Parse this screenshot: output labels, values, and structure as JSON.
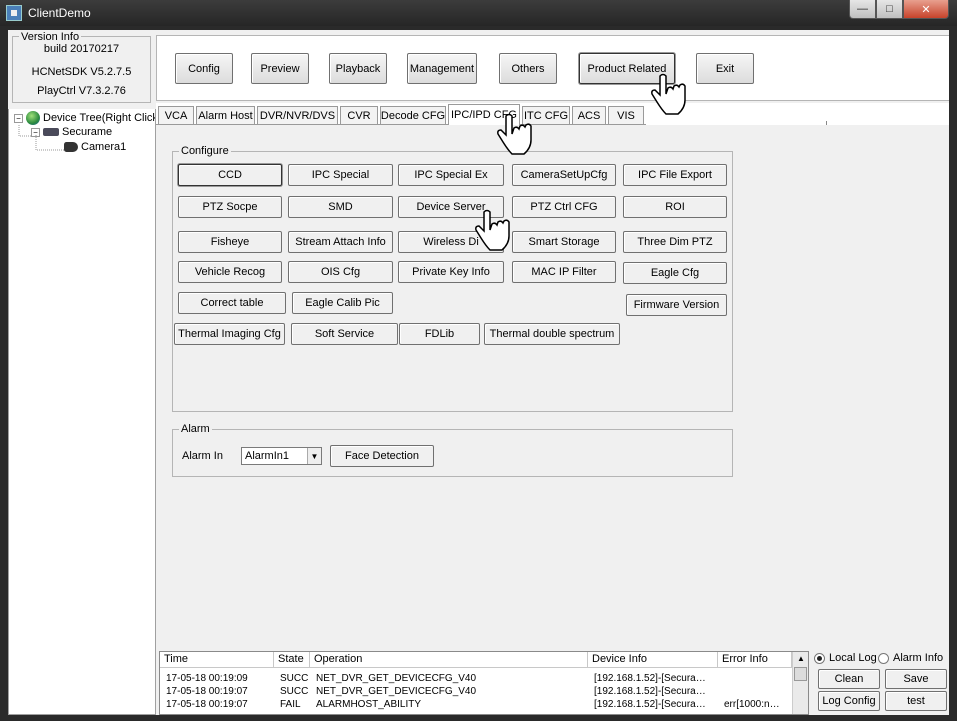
{
  "window": {
    "title": "ClientDemo",
    "controls": {
      "minimize": "—",
      "maximize": "□",
      "close": "✕"
    }
  },
  "version_info": {
    "legend": "Version Info",
    "build": "build 20170217",
    "sdk": "HCNetSDK V5.2.7.5",
    "playctrl": "PlayCtrl V7.3.2.76"
  },
  "top_buttons": [
    {
      "label": "Config"
    },
    {
      "label": "Preview"
    },
    {
      "label": "Playback"
    },
    {
      "label": "Management"
    },
    {
      "label": "Others"
    },
    {
      "label": "Product Related"
    },
    {
      "label": "Exit"
    }
  ],
  "device_tree": {
    "root": "Device Tree(Right Click t",
    "device": "Securame",
    "camera": "Camera1"
  },
  "tabs": [
    {
      "label": "VCA"
    },
    {
      "label": "Alarm Host"
    },
    {
      "label": "DVR/NVR/DVS"
    },
    {
      "label": "CVR"
    },
    {
      "label": "Decode CFG"
    },
    {
      "label": "IPC/IPD CFG"
    },
    {
      "label": "ITC CFG"
    },
    {
      "label": "ACS"
    },
    {
      "label": "VIS"
    }
  ],
  "active_tab": "IPC/IPD CFG",
  "configure": {
    "legend": "Configure",
    "buttons": {
      "ccd": "CCD",
      "ipc_special": "IPC Special",
      "ipc_special_ex": "IPC Special Ex",
      "camera_setup_cfg": "CameraSetUpCfg",
      "ipc_file_export": "IPC File Export",
      "ptz_scope": "PTZ Socpe",
      "smd": "SMD",
      "device_server": "Device Server",
      "ptz_ctrl_cfg": "PTZ  Ctrl CFG",
      "roi": "ROI",
      "fisheye": "Fisheye",
      "stream_attach_info": "Stream Attach Info",
      "wireless_dial": "Wireless Di",
      "smart_storage": "Smart Storage",
      "three_dim_ptz": "Three Dim PTZ",
      "vehicle_recog": "Vehicle Recog",
      "ois_cfg": "OIS Cfg",
      "private_key_info": "Private Key Info",
      "mac_ip_filter": "MAC IP Filter",
      "eagle_cfg": "Eagle Cfg",
      "correct_table": "Correct table",
      "eagle_calib_pic": "Eagle Calib Pic",
      "firmware_version": "Firmware Version",
      "thermal_imaging_cfg": "Thermal Imaging Cfg",
      "soft_service": "Soft Service",
      "fdlib": "FDLib",
      "thermal_double_spectrum": "Thermal double spectrum"
    }
  },
  "alarm": {
    "legend": "Alarm",
    "alarm_in_label": "Alarm In",
    "alarm_in_value": "AlarmIn1",
    "face_detection": "Face Detection"
  },
  "log": {
    "columns": [
      "Time",
      "State",
      "Operation",
      "Device Info",
      "Error Info"
    ],
    "rows": [
      {
        "time": "17-05-18 00:19:09",
        "state": "SUCC",
        "operation": "NET_DVR_GET_DEVICECFG_V40",
        "device": "[192.168.1.52]-[Secura…",
        "error": ""
      },
      {
        "time": "17-05-18 00:19:07",
        "state": "SUCC",
        "operation": "NET_DVR_GET_DEVICECFG_V40",
        "device": "[192.168.1.52]-[Secura…",
        "error": ""
      },
      {
        "time": "17-05-18 00:19:07",
        "state": "FAIL",
        "operation": "ALARMHOST_ABILITY",
        "device": "[192.168.1.52]-[Secura…",
        "error": "err[1000:n…"
      }
    ]
  },
  "log_controls": {
    "local_log": "Local Log",
    "alarm_info": "Alarm Info",
    "clean": "Clean",
    "save": "Save",
    "log_config": "Log Config",
    "test": "test"
  }
}
